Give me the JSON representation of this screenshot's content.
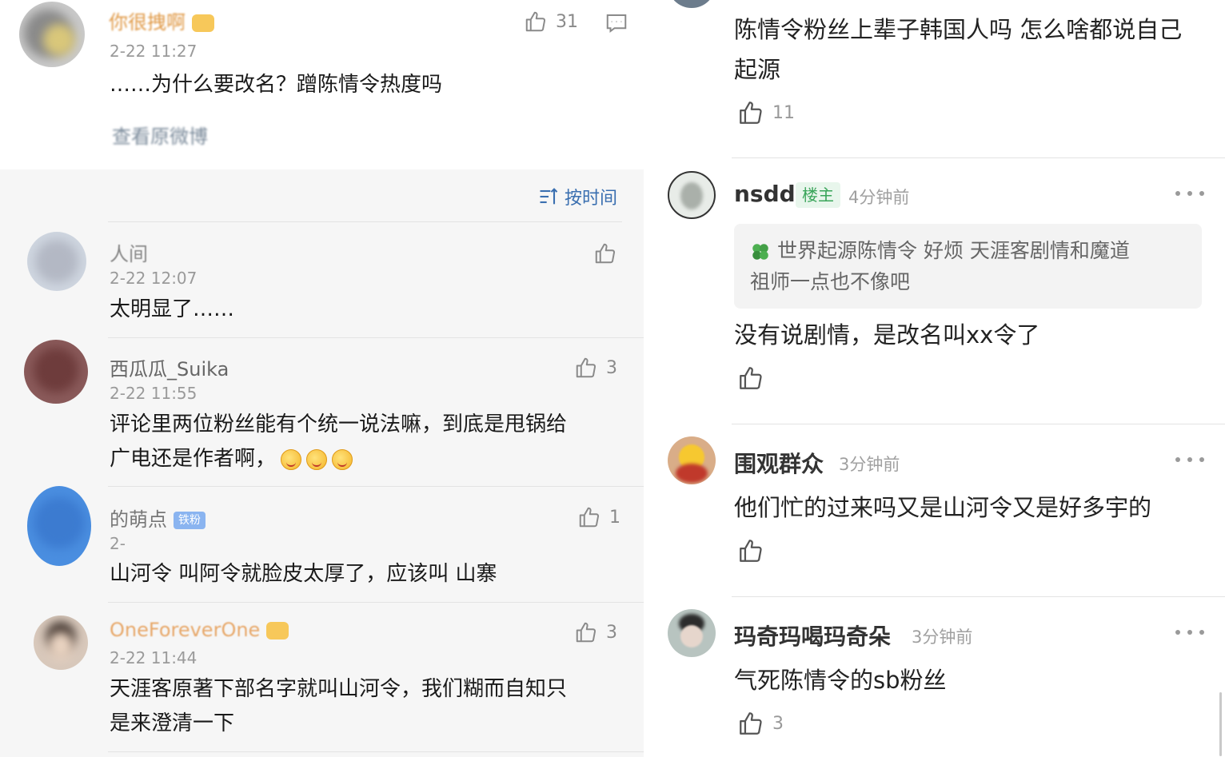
{
  "left": {
    "top_comment": {
      "username": "你很拽啊",
      "time": "2-22 11:27",
      "text": "……为什么要改名？蹭陈情令热度吗",
      "likes": "31",
      "view_original_link": "查看原微博"
    },
    "sort_label": "按时间",
    "replies": [
      {
        "username": "人间",
        "time": "2-22 12:07",
        "text": [
          "太明显了……"
        ],
        "likes": ""
      },
      {
        "username": "西瓜瓜_Suika",
        "time": "2-22 11:55",
        "text": [
          "评论里两位粉丝能有个统一说法嘛，到底是甩锅给",
          "广电还是作者啊，"
        ],
        "likes": "3"
      },
      {
        "username": "的萌点",
        "time": "2-",
        "text": [
          "山河令  叫阿令就脸皮太厚了，应该叫 山寨"
        ],
        "likes": "1",
        "badge": "铁粉"
      },
      {
        "username": "OneForeverOne",
        "time": "2-22 11:44",
        "text": [
          "天涯客原著下部名字就叫山河令，我们糊而自知只",
          "是来澄清一下"
        ],
        "likes": "3"
      }
    ]
  },
  "right": {
    "first_post": {
      "text": [
        "陈情令粉丝上辈子韩国人吗 怎么啥都说自己",
        "起源"
      ],
      "likes": "11"
    },
    "comments": [
      {
        "name": "nsdd",
        "tag": "楼主",
        "time": "4分钟前",
        "quote": [
          "世界起源陈情令  好烦    天涯客剧情和魔道",
          "祖师一点也不像吧"
        ],
        "text": "没有说剧情，是改名叫xx令了",
        "likes": ""
      },
      {
        "name": "围观群众",
        "time": "3分钟前",
        "text": "他们忙的过来吗又是山河令又是好多宇的",
        "likes": ""
      },
      {
        "name": "玛奇玛喝玛奇朵",
        "time": "3分钟前",
        "text": "气死陈情令的sb粉丝",
        "likes": "3"
      }
    ]
  },
  "colors": {
    "link_blue": "#3a6fb0",
    "tag_green": "#3aa55a",
    "muted": "#9a9a9a"
  },
  "icons": [
    "thumbs-up-icon",
    "comment-icon",
    "sort-icon",
    "more-icon",
    "clover-icon",
    "emoji-icon"
  ]
}
